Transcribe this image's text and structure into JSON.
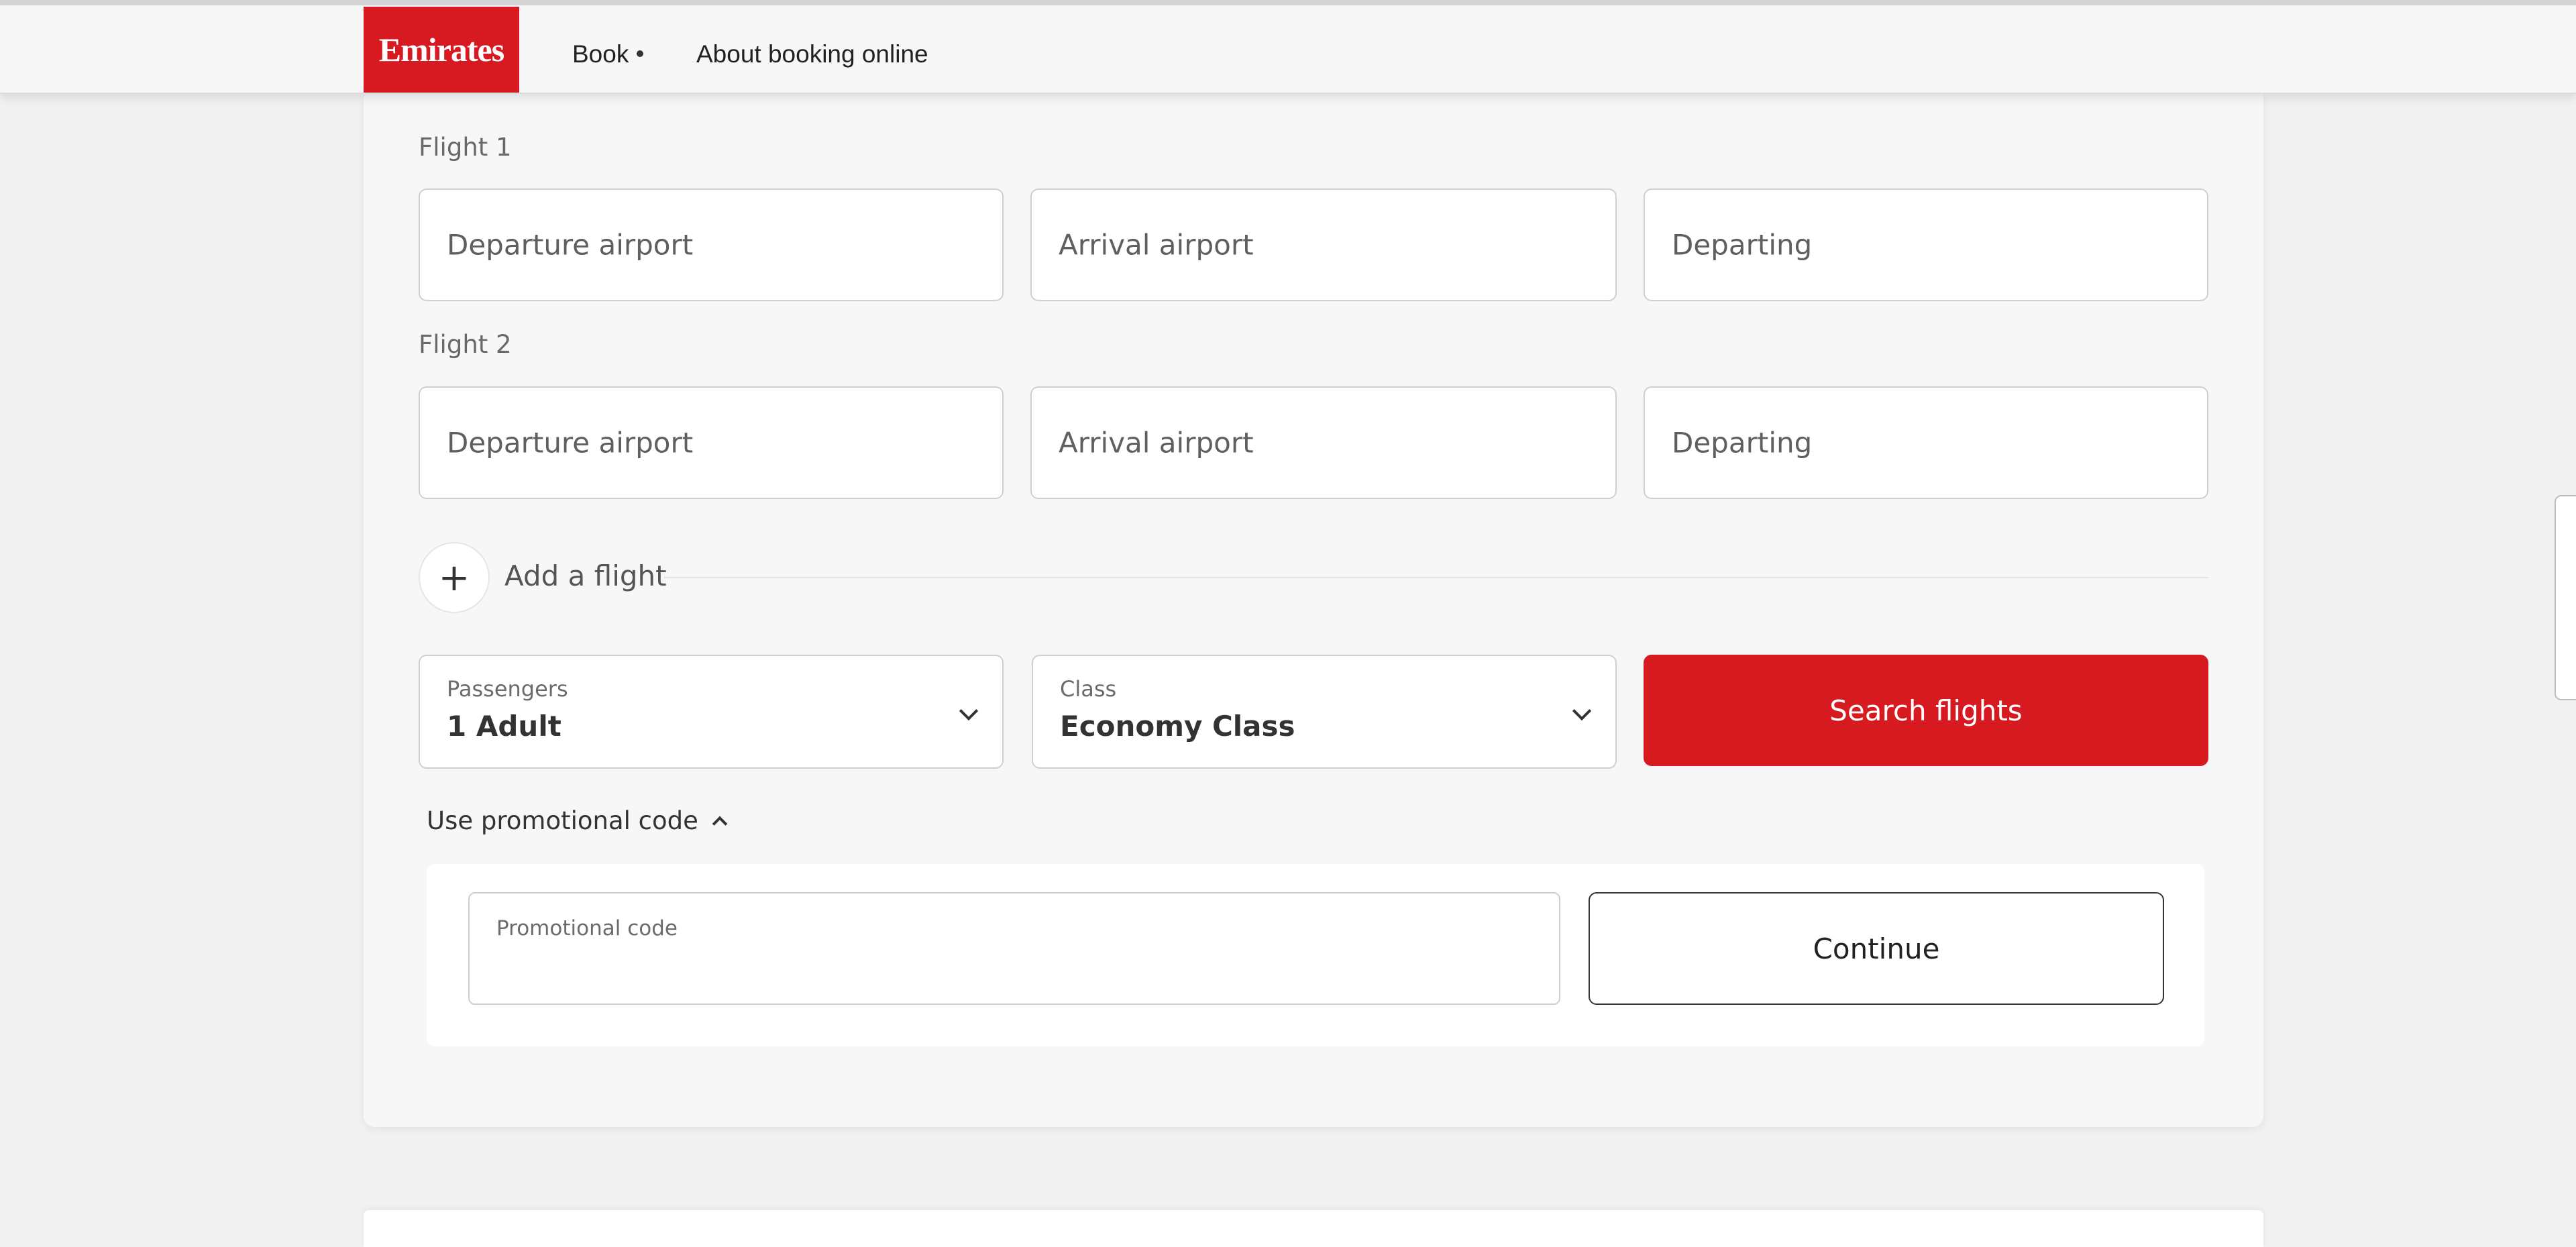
{
  "nav": {
    "logo_text": "Emirates",
    "book_label": "Book",
    "about_label": "About booking online"
  },
  "flights": [
    {
      "label": "Flight 1",
      "departure_placeholder": "Departure airport",
      "arrival_placeholder": "Arrival airport",
      "departing_placeholder": "Departing"
    },
    {
      "label": "Flight 2",
      "departure_placeholder": "Departure airport",
      "arrival_placeholder": "Arrival airport",
      "departing_placeholder": "Departing"
    }
  ],
  "add_flight": {
    "icon": "+",
    "label": "Add a flight"
  },
  "passengers": {
    "label": "Passengers",
    "value": "1 Adult"
  },
  "cabin_class": {
    "label": "Class",
    "value": "Economy Class"
  },
  "search_button_label": "Search flights",
  "promo": {
    "toggle_label": "Use promotional code",
    "input_label": "Promotional code",
    "input_value": "",
    "continue_label": "Continue"
  },
  "colors": {
    "brand_red": "#d71a21",
    "page_bg": "#f1f1f1"
  }
}
